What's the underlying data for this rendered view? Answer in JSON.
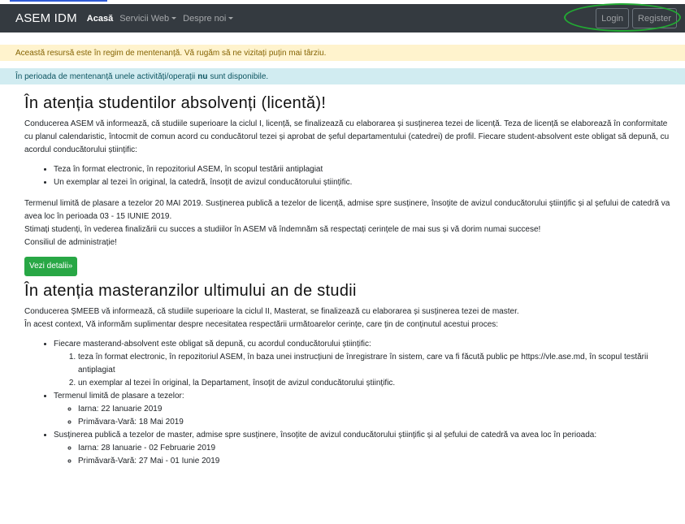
{
  "navbar": {
    "brand": "ASEM IDM",
    "links": [
      "Acasă",
      "Servicii Web",
      "Despre noi"
    ],
    "login": "Login",
    "register": "Register"
  },
  "alerts": {
    "warning": "Această resursă este în regim de mentenanță. Vă rugăm să ne vizitați puțin mai târziu.",
    "info_pre": "În perioada de mentenanță unele activități/operații",
    "info_bold": "nu",
    "info_post": "sunt disponibile."
  },
  "section1": {
    "title": "În atenția studentilor absolvenți (licentă)!",
    "intro": "Conducerea ASEM vă informează, că studiile superioare la ciclul I, licență, se finalizează cu elaborarea și susținerea tezei de licență. Teza de licență se elaborează în conformitate cu planul calendaristic, întocmit de comun acord cu conducătorul tezei și aprobat de șeful departamentului (catedrei) de profil. Fiecare student-absolvent este obligat să depună, cu acordul conducătorului științific:",
    "items": [
      "Teza în format electronic, în repozitoriul ASEM, în scopul testării antiplagiat",
      "Un exemplar al tezei în original, la catedră, însoțit de avizul conducătorului științific."
    ],
    "deadline": "Termenul limită de plasare a tezelor 20 MAI 2019. Susținerea publică a tezelor de licență, admise spre susținere, însoțite de avizul conducătorului științific și al șefului de catedră va avea loc în perioada 03 - 15 IUNIE 2019.",
    "closing": "Stimați studenți, în vederea finalizării cu succes a studiilor în ASEM vă îndemnăm să respectați cerințele de mai sus și vă dorim numai succese!",
    "signature": "Consiliul de administrație!",
    "button": "Vezi detalii»"
  },
  "section2": {
    "title": "În atenția masteranzilor ultimului an de studii",
    "intro1": "Conducerea ȘMEEB vă informează, că studiile superioare la ciclul II, Masterat, se finalizează cu elaborarea și susținerea tezei de master.",
    "intro2": "În acest context, Vă informăm suplimentar despre necesitatea respectării următoarelor cerințe, care țin de conținutul acestui proces:",
    "item1": "Fiecare masterand-absolvent este obligat să depună, cu acordul conducătorului științific:",
    "item1_sub": [
      "teza în format electronic, în repozitoriul ASEM, în baza unei instrucțiuni de înregistrare în sistem, care va fi făcută public pe https://vle.ase.md, în scopul testării antiplagiat",
      "un exemplar al tezei în original, la Departament, însoțit de avizul conducătorului științific."
    ],
    "item2": "Termenul limită de plasare a tezelor:",
    "item2_sub": [
      "Iarna: 22 Ianuarie 2019",
      "Primăvara-Vară: 18 Mai 2019"
    ],
    "item3": "Susținerea publică a tezelor de master, admise spre susținere, însoțite de avizul conducătorului științific și al șefului de catedră va avea loc în perioada:",
    "item3_sub": [
      "Iarna: 28 Ianuarie - 02 Februarie 2019",
      "Primăvară-Vară: 27 Mai - 01 Iunie 2019"
    ]
  }
}
